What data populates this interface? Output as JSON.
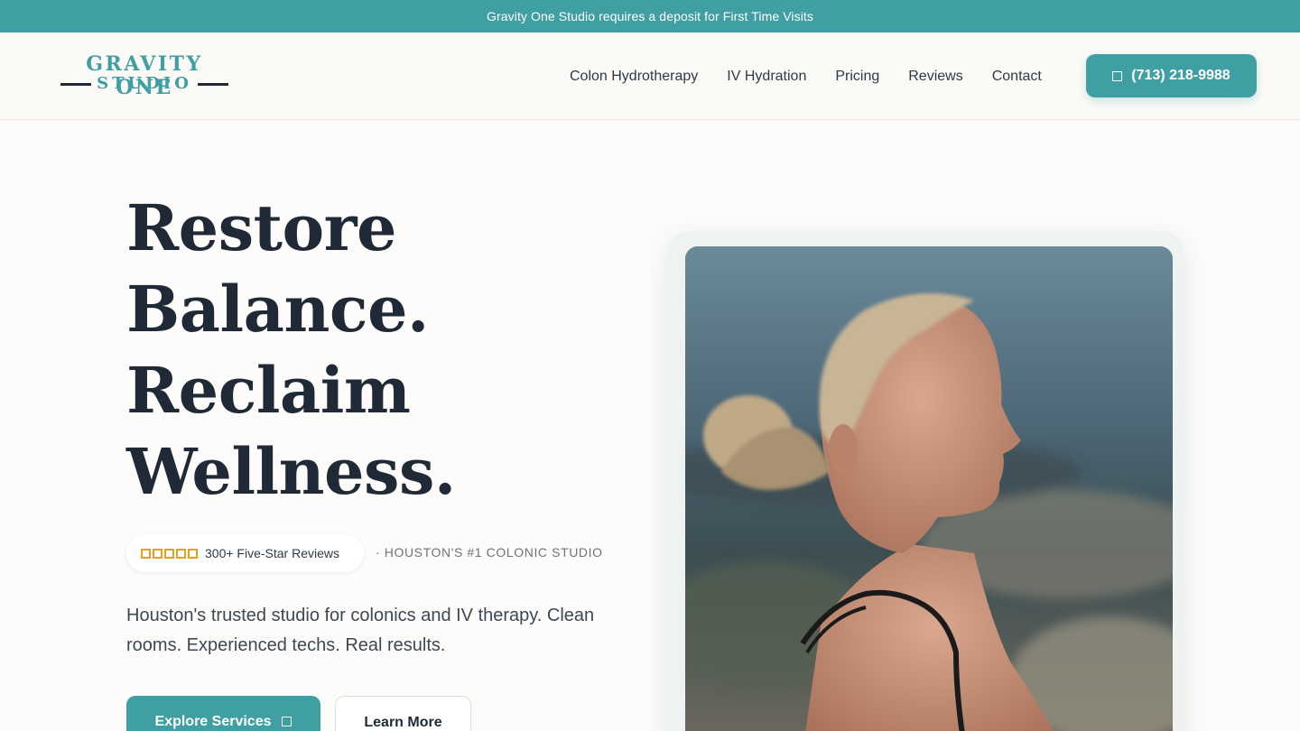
{
  "announcement": "Gravity One Studio requires a deposit for First Time Visits",
  "logo": {
    "line1": "GRAVITY ONE",
    "line2": "STUDIO"
  },
  "nav": {
    "items": [
      "Colon Hydrotherapy",
      "IV Hydration",
      "Pricing",
      "Reviews",
      "Contact"
    ],
    "phone_label": "(713) 218-9988",
    "phone_icon": "phone-icon"
  },
  "hero": {
    "title_lines": [
      "Restore",
      "Balance.",
      "Reclaim",
      "Wellness."
    ],
    "rating": {
      "stars": 5,
      "text": "300+ Five-Star Reviews",
      "star_color": "#e8a019"
    },
    "tagline": "· HOUSTON'S #1 COLONIC STUDIO",
    "lead": "Houston's trusted studio for colonics and IV therapy. Clean rooms. Experienced techs. Real results.",
    "primary_button": "Explore Services",
    "primary_icon": "arrow-icon",
    "secondary_button": "Learn More"
  },
  "colors": {
    "brand": "#3f9fa3",
    "text_dark": "#1f2a36",
    "background": "#fdfcfa"
  }
}
